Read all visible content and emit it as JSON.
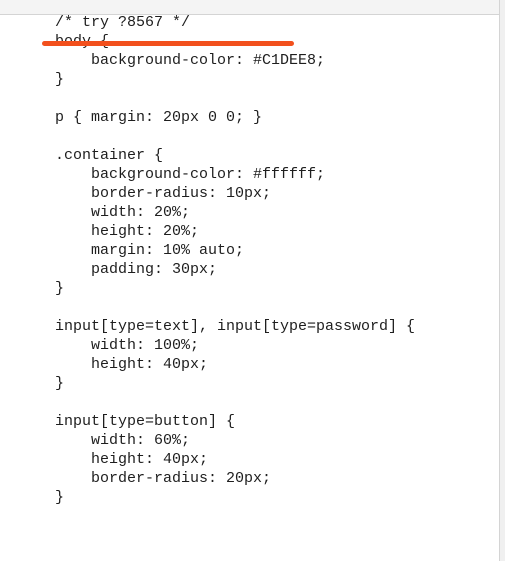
{
  "code": {
    "lines": [
      "/* try ?8567 */",
      "body {",
      "    background-color: #C1DEE8;",
      "}",
      "",
      "p { margin: 20px 0 0; }",
      "",
      ".container {",
      "    background-color: #ffffff;",
      "    border-radius: 10px;",
      "    width: 20%;",
      "    height: 20%;",
      "    margin: 10% auto;",
      "    padding: 30px;",
      "}",
      "",
      "input[type=text], input[type=password] {",
      "    width: 100%;",
      "    height: 40px;",
      "}",
      "",
      "input[type=button] {",
      "    width: 60%;",
      "    height: 40px;",
      "    border-radius: 20px;",
      "}"
    ]
  },
  "annotation": {
    "color": "#f2501d"
  }
}
